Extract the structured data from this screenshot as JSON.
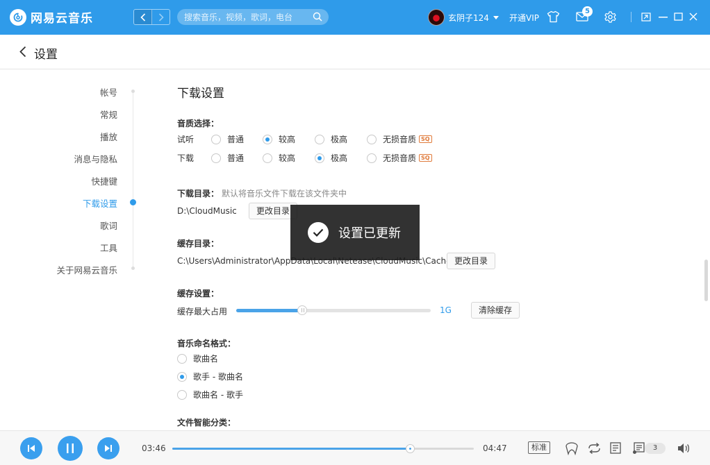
{
  "app": {
    "name": "网易云音乐",
    "search_placeholder": "搜索音乐，视频，歌词，电台",
    "username": "玄阴子124",
    "vip_label": "开通VIP",
    "mail_badge": "5",
    "brand_color": "#2f9bea"
  },
  "page": {
    "title": "设置"
  },
  "nav": {
    "active_index": 5,
    "items": [
      "帐号",
      "常规",
      "播放",
      "消息与隐私",
      "快捷键",
      "下载设置",
      "歌词",
      "工具",
      "关于网易云音乐"
    ]
  },
  "download": {
    "section_title": "下载设置",
    "quality_label": "音质选择：",
    "quality_options": [
      "普通",
      "较高",
      "极高",
      "无损音质"
    ],
    "sq_tag": "SQ",
    "preview_label": "试听",
    "preview_selected": 1,
    "download_label": "下载",
    "download_selected": 2,
    "dir_label": "下载目录：",
    "dir_hint": "默认将音乐文件下载在该文件夹中",
    "dir_path": "D:\\CloudMusic",
    "change_dir_button": "更改目录",
    "cache_dir_label": "缓存目录：",
    "cache_dir_path": "C:\\Users\\Administrator\\AppData\\Local\\Netease\\CloudMusic\\Cache",
    "cache_change_button": "更改目录",
    "cache_settings_label": "缓存设置：",
    "cache_max_label": "缓存最大占用",
    "cache_value": "1G",
    "cache_slider_fraction": 0.34,
    "clear_cache_button": "清除缓存",
    "naming_label": "音乐命名格式：",
    "naming_options": [
      "歌曲名",
      "歌手 - 歌曲名",
      "歌曲名 - 歌手"
    ],
    "naming_selected": 1,
    "smart_sort_label": "文件智能分类："
  },
  "toast": {
    "message": "设置已更新"
  },
  "player": {
    "current_time": "03:46",
    "total_time": "04:47",
    "progress_fraction": 0.787,
    "quality_tag": "标准",
    "playlist_count": "3"
  }
}
